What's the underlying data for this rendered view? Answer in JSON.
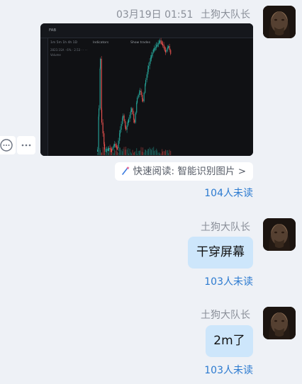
{
  "msg1": {
    "timestamp": "03月19日 01:51",
    "sender": "土狗大队长",
    "quick_read_label": "快速阅读: 智能识别图片",
    "quick_read_chevron": ">",
    "unread": "104人未读",
    "chart_labels": {
      "indicators": "Indicators",
      "show_trades": "Show trades",
      "top_left": "FAB",
      "row2": "1m  5m  1h  4h  1D",
      "stats": "2823.1SA · 6% · 2.53  ·  ·  ·  ·",
      "volume": "Volume"
    }
  },
  "msg2": {
    "sender": "土狗大队长",
    "text": "干穿屏幕",
    "unread": "103人未读"
  },
  "msg3": {
    "sender": "土狗大队长",
    "text": "2m了",
    "unread": "103人未读"
  },
  "colors": {
    "background": "#eef1f6",
    "bubble": "#cde6fb",
    "unread": "#2b7ad0",
    "meta": "#8a8f99",
    "candle_up": "#26a69a",
    "candle_down": "#ef5350"
  },
  "icons": {
    "comment": "comment-icon",
    "more": "more-icon",
    "magic_wand": "magic-wand-icon"
  }
}
